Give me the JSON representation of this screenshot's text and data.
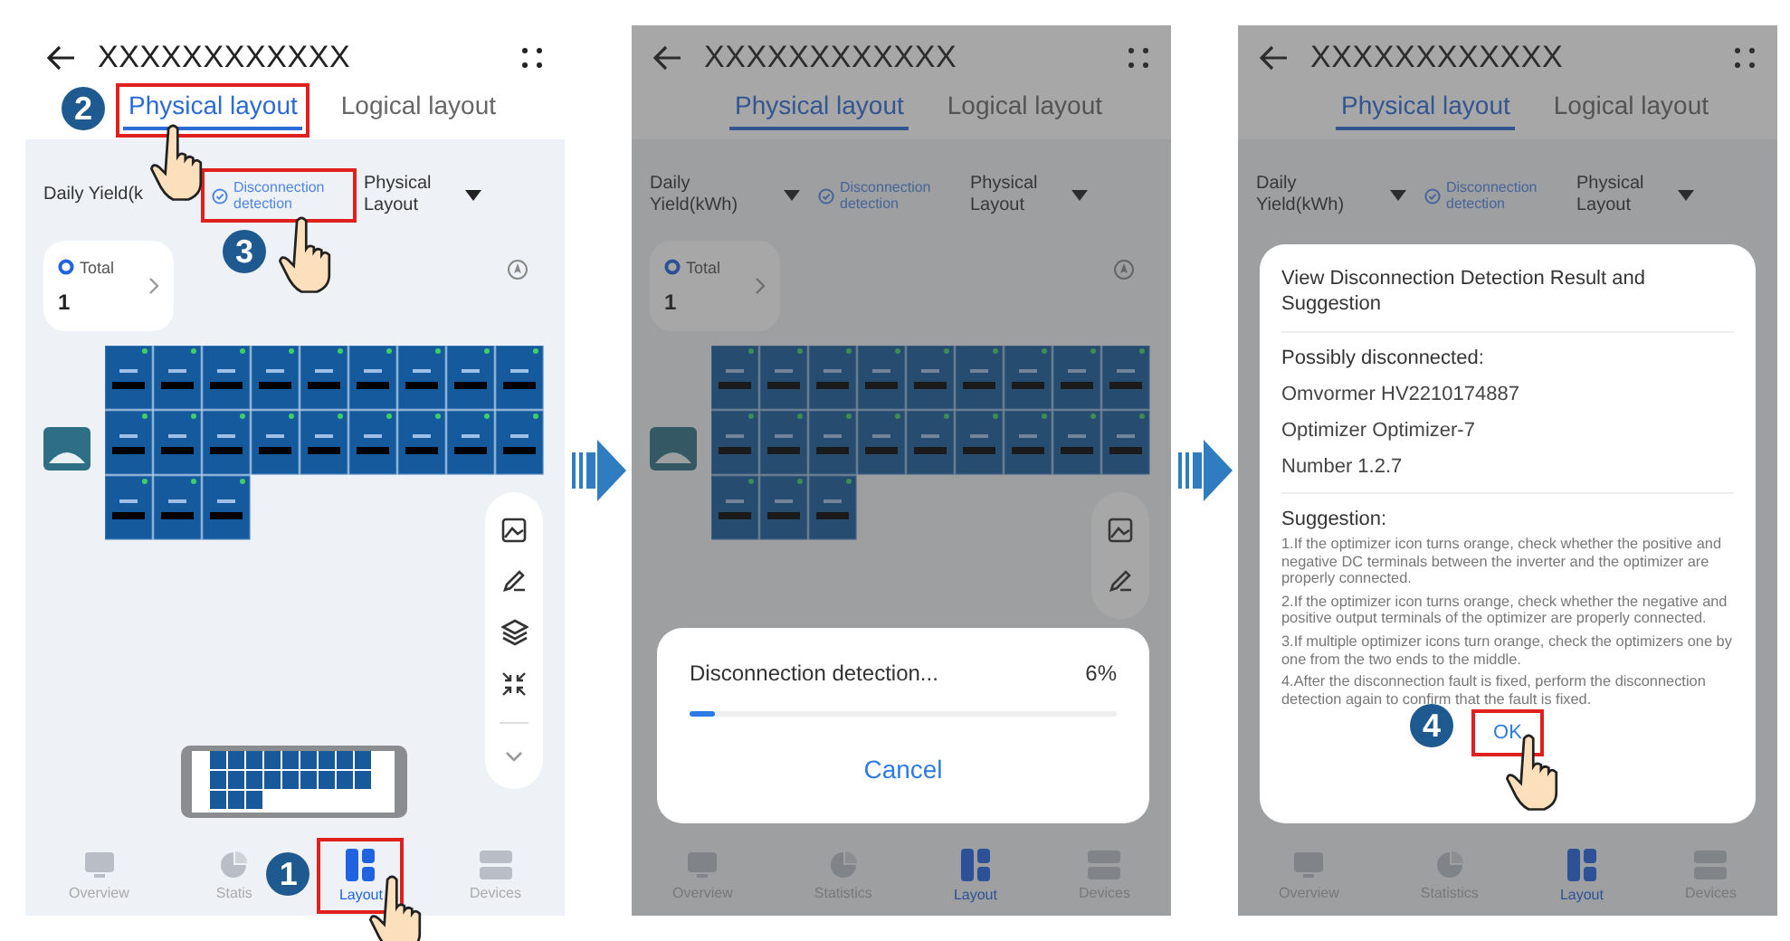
{
  "steps": [
    {
      "header": {
        "title": "XXXXXXXXXXXX"
      },
      "tabs": [
        {
          "label": "Physical layout",
          "selected": true,
          "callout": "2"
        },
        {
          "label": "Logical layout",
          "selected": false
        }
      ],
      "filters": {
        "metric": "Daily Yield(k",
        "detection": "Disconnection detection",
        "detection_callout": "3",
        "view": "Physical Layout"
      },
      "total": {
        "label": "Total",
        "value": "1"
      },
      "panels": true,
      "toolbar": [
        {
          "kind": "image"
        },
        {
          "kind": "pen"
        },
        {
          "kind": "layers"
        },
        {
          "kind": "collapse"
        },
        {
          "kind": "chevron"
        }
      ],
      "minimap": true,
      "nav": [
        {
          "kind": "overview",
          "label": "Overview",
          "selected": false
        },
        {
          "kind": "statistics",
          "label": "Statis",
          "selected": false
        },
        {
          "kind": "layout",
          "label": "Layout",
          "selected": true,
          "callout": "1"
        },
        {
          "kind": "devices",
          "label": "Devices",
          "selected": false
        }
      ]
    },
    {
      "dimmed": true,
      "header": {
        "title": "XXXXXXXXXXXX"
      },
      "tabs": [
        {
          "label": "Physical layout",
          "selected": true
        },
        {
          "label": "Logical layout",
          "selected": false
        }
      ],
      "filters": {
        "metric": "Daily Yield(kWh)",
        "detection": "Disconnection detection",
        "view": "Physical Layout"
      },
      "total": {
        "label": "Total",
        "value": "1"
      },
      "panels": true,
      "toolbar": [
        {
          "kind": "image"
        },
        {
          "kind": "pen"
        }
      ],
      "nav": [
        {
          "kind": "overview",
          "label": "Overview",
          "selected": false
        },
        {
          "kind": "statistics",
          "label": "Statistics",
          "selected": false
        },
        {
          "kind": "layout",
          "label": "Layout",
          "selected": true
        },
        {
          "kind": "devices",
          "label": "Devices",
          "selected": false
        }
      ],
      "dialog": {
        "kind": "progress",
        "text": "Disconnection detection...",
        "percent": "6%",
        "level": 0.06,
        "button": "Cancel"
      }
    },
    {
      "dimmed": true,
      "header": {
        "title": "XXXXXXXXXXXX"
      },
      "tabs": [
        {
          "label": "Physical layout",
          "selected": true
        },
        {
          "label": "Logical layout",
          "selected": false
        }
      ],
      "filters": {
        "metric": "Daily Yield(kWh)",
        "detection": "Disconnection detection",
        "view": "Physical Layout"
      },
      "nav": [
        {
          "kind": "overview",
          "label": "Overview",
          "selected": false
        },
        {
          "kind": "statistics",
          "label": "Statistics",
          "selected": false
        },
        {
          "kind": "layout",
          "label": "Layout",
          "selected": true
        },
        {
          "kind": "devices",
          "label": "Devices",
          "selected": false
        }
      ],
      "dialog": {
        "kind": "result",
        "title": "View Disconnection Detection Result and Suggestion",
        "heading": "Possibly disconnected:",
        "lines": [
          "Omvormer HV2210174887",
          "Optimizer Optimizer-7",
          "Number 1.2.7"
        ],
        "suggestion_heading": "Suggestion:",
        "suggestions": [
          "1.If the optimizer icon turns orange, check whether the positive and negative DC terminals between the inverter and the optimizer are properly connected.",
          "2.If the optimizer icon turns orange, check whether the negative and positive output terminals of the optimizer are properly connected.",
          "3.If multiple optimizer icons turn orange, check the optimizers one by one from the two ends to the middle.",
          "4.After the disconnection fault is fixed, perform the disconnection detection again to confirm that the fault is fixed."
        ],
        "button": "OK",
        "button_callout": "4"
      }
    }
  ]
}
